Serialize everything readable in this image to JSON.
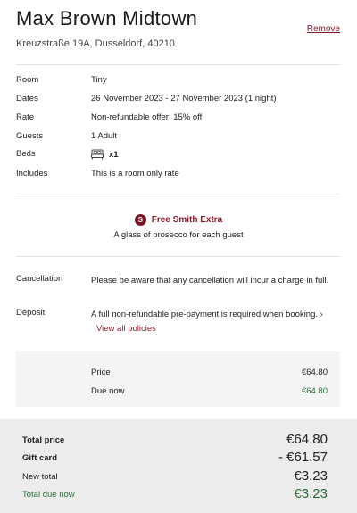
{
  "hotel": {
    "name": "Max Brown Midtown",
    "address": "Kreuzstraße 19A, Dusseldorf, 40210",
    "remove_label": "Remove"
  },
  "details": [
    {
      "label": "Room",
      "value": "Tiny"
    },
    {
      "label": "Dates",
      "value": "26 November 2023 - 27 November 2023 (1 night)"
    },
    {
      "label": "Rate",
      "value": "Non-refundable offer: 15% off"
    },
    {
      "label": "Guests",
      "value": "1 Adult"
    },
    {
      "label": "Beds",
      "value": "x1",
      "icon": "bed-icon"
    },
    {
      "label": "Includes",
      "value": "This is a room only rate"
    }
  ],
  "extra": {
    "badge": "S",
    "title": "Free Smith Extra",
    "description": "A glass of prosecco for each guest"
  },
  "policies": {
    "cancellation_label": "Cancellation",
    "cancellation_text": "Please be aware that any cancellation will incur a charge in full.",
    "deposit_label": "Deposit",
    "deposit_text": "A full non-refundable pre-payment is required when booking.",
    "view_all_label": "View all policies"
  },
  "price_box": {
    "price_label": "Price",
    "price_value": "€64.80",
    "due_now_label": "Due now",
    "due_now_value": "€64.80"
  },
  "totals": {
    "total_price_label": "Total price",
    "total_price_value": "€64.80",
    "gift_card_label": "Gift card",
    "gift_card_value": "- €61.57",
    "new_total_label": "New total",
    "new_total_value": "€3.23",
    "total_due_label": "Total due now",
    "total_due_value": "€3.23"
  },
  "colors": {
    "accent": "#8a1a2a",
    "green": "#2f6b3a"
  }
}
